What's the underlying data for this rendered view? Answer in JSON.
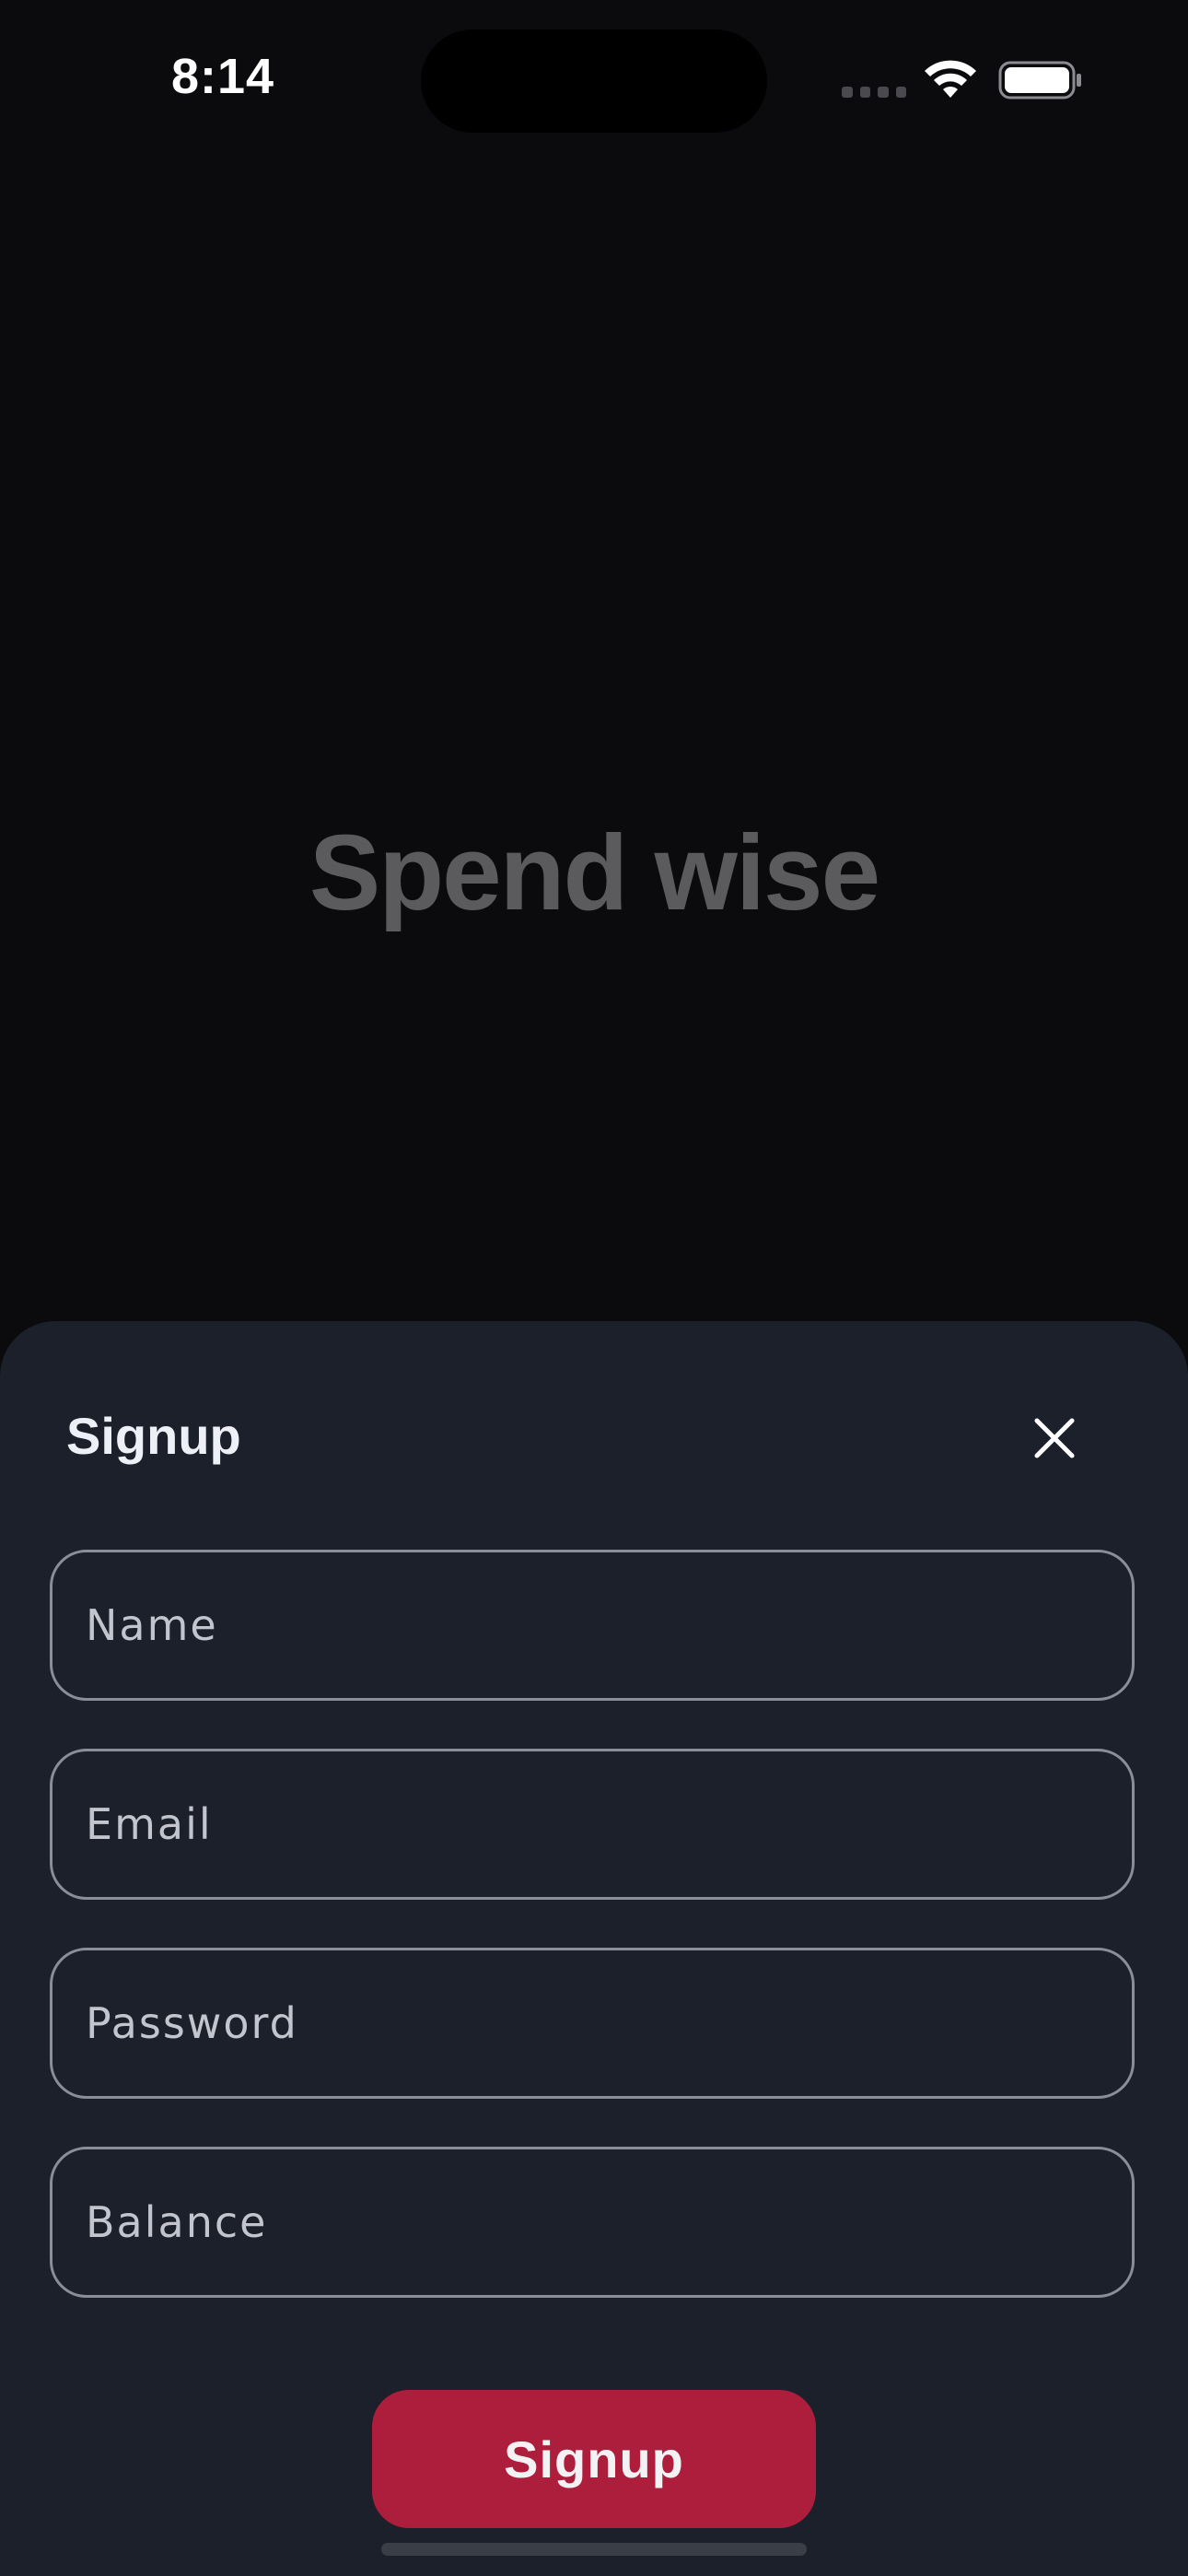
{
  "status_bar": {
    "time": "8:14",
    "icons": [
      "signal-icon",
      "wifi-icon",
      "battery-icon"
    ]
  },
  "hero": {
    "title": "Spend wise"
  },
  "signup_sheet": {
    "title": "Signup",
    "close_icon": "close-icon",
    "fields": {
      "name": {
        "placeholder": "Name",
        "value": ""
      },
      "email": {
        "placeholder": "Email",
        "value": ""
      },
      "password": {
        "placeholder": "Password",
        "value": ""
      },
      "balance": {
        "placeholder": "Balance",
        "value": ""
      }
    },
    "submit_label": "Signup"
  },
  "colors": {
    "background": "#0b0b0d",
    "sheet": "#1b202b",
    "accent": "#ad1e3c",
    "hero_text": "#5b5b5e"
  }
}
